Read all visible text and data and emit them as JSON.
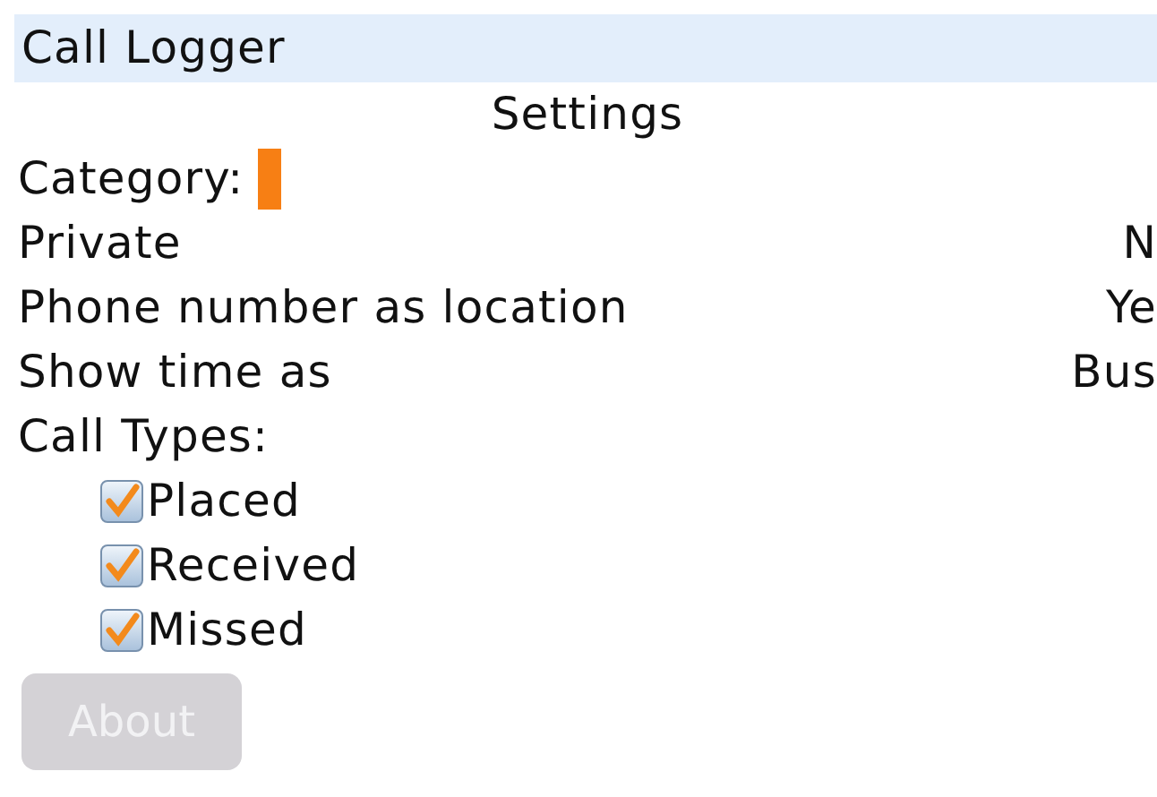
{
  "window": {
    "title": "Call Logger"
  },
  "heading": "Settings",
  "category": {
    "label": "Category:"
  },
  "options": [
    {
      "label": "Private",
      "value": "N"
    },
    {
      "label": "Phone number as location",
      "value": "Ye"
    },
    {
      "label": "Show time as",
      "value": "Bus"
    }
  ],
  "call_types": {
    "label": "Call Types:",
    "items": [
      {
        "label": "Placed",
        "checked": true
      },
      {
        "label": "Received",
        "checked": true
      },
      {
        "label": "Missed",
        "checked": true
      }
    ]
  },
  "button": {
    "label": "About",
    "disabled": true
  }
}
